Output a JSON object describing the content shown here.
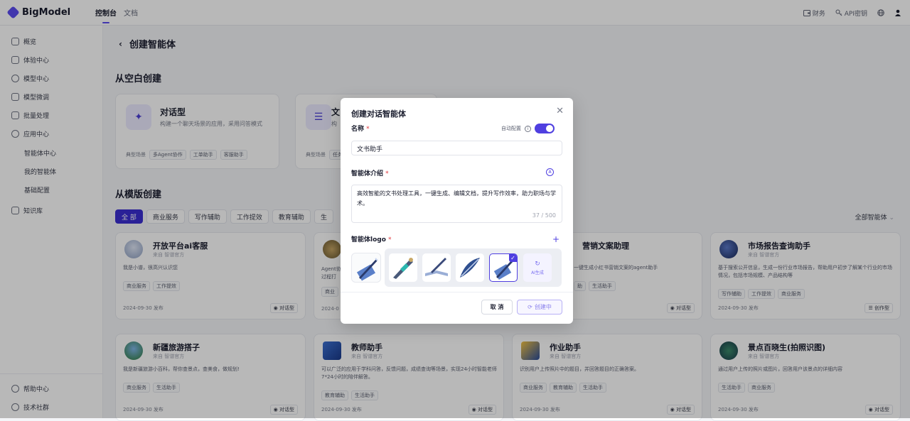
{
  "app": {
    "name": "BigModel"
  },
  "nav": {
    "tabs": [
      {
        "label": "控制台",
        "active": true
      },
      {
        "label": "文档",
        "active": false
      }
    ]
  },
  "topright": {
    "finance": "财务",
    "apikey": "API密钥"
  },
  "sidebar": {
    "items": [
      {
        "label": "概览",
        "icon": "monitor-icon"
      },
      {
        "label": "体验中心",
        "icon": "experience-icon"
      },
      {
        "label": "模型中心",
        "icon": "model-icon"
      },
      {
        "label": "模型微调",
        "icon": "tune-icon"
      },
      {
        "label": "批量处理",
        "icon": "batch-icon"
      },
      {
        "label": "应用中心",
        "icon": "app-icon"
      }
    ],
    "subitems": [
      "智能体中心",
      "我的智能体",
      "基础配置"
    ],
    "kb": "知识库",
    "bottom": [
      {
        "label": "帮助中心",
        "icon": "help-icon"
      },
      {
        "label": "技术社群",
        "icon": "community-icon"
      }
    ]
  },
  "page": {
    "back_title": "创建智能体",
    "blank_title": "从空白创建",
    "template_title": "从模版创建",
    "blank_cards": [
      {
        "title": "对话型",
        "desc": "构建一个聊天场景的应用，采用问答模式",
        "scene_label": "典型场景",
        "tags": [
          "多Agent协作",
          "工单助手",
          "客服助手"
        ]
      },
      {
        "title": "文",
        "desc": "构",
        "scene_label": "典型场景",
        "tags": [
          "任务"
        ]
      }
    ],
    "filters": [
      "全 部",
      "商业服务",
      "写作辅助",
      "工作提效",
      "教育辅助",
      "生"
    ],
    "all_types": "全部智能体",
    "cards": [
      {
        "title": "开放平台ai客服",
        "source": "来自  智谱官方",
        "desc": "我是小谱，很高兴认识您",
        "tags": [
          "商业服务",
          "工作提效"
        ],
        "date": "2024-09-30 发布",
        "type": "对话型"
      },
      {
        "title": "",
        "source": "",
        "desc": "Agent协\n过程打",
        "tags": [
          "商业"
        ],
        "date": "2024-0",
        "type": ""
      },
      {
        "title": "营销文案助理",
        "source": "",
        "desc": "一键生成小红书营销文案的agent助手",
        "tags": [
          "助",
          "生活助手"
        ],
        "date": "",
        "type": "对话型"
      },
      {
        "title": "市场报告查询助手",
        "source": "来自  智谱官方",
        "desc": "基于搜索公开信息，生成一份行业市场报告，帮助用户初步了解某个行业的市场情况，包括市场规模、产品结构等",
        "tags": [
          "写作辅助",
          "工作提效",
          "商业服务"
        ],
        "date": "2024-09-30 发布",
        "type": "创作型"
      },
      {
        "title": "新疆旅游搭子",
        "source": "来自  智谱官方",
        "desc": "我是新疆旅游小百科，帮你查景点，查美食，做规划!",
        "tags": [
          "商业服务",
          "生活助手"
        ],
        "date": "2024-09-30 发布",
        "type": "对话型"
      },
      {
        "title": "教师助手",
        "source": "来自  智谱官方",
        "desc": "可以广泛的应用于学科问答，反馈问题，成绩查询等场景，实现24小时智能老师 7*24小时的陪伴解答。",
        "tags": [
          "教育辅助",
          "生活助手"
        ],
        "date": "2024-09-30 发布",
        "type": "对话型"
      },
      {
        "title": "作业助手",
        "source": "来自  智谱官方",
        "desc": "识别用户上传照片中的题目，并回答题目的正确答案。",
        "tags": [
          "商业服务",
          "教育辅助",
          "生活助手"
        ],
        "date": "2024-09-30 发布",
        "type": "对话型"
      },
      {
        "title": "景点百晓生(拍照识图)",
        "source": "来自  智谱官方",
        "desc": "通过用户上传的照片或图片，回答用户该景点的详细内容",
        "tags": [
          "生活助手",
          "商业服务"
        ],
        "date": "2024-09-30 发布",
        "type": "对话型"
      }
    ]
  },
  "modal": {
    "title": "创建对话智能体",
    "name_label": "名称",
    "required": "*",
    "auto_config": "自动配置",
    "name_value": "文书助手",
    "intro_label": "智能体介绍",
    "intro_value": "高效智能的文书处理工具，一键生成、编辑文档，提升写作效率，助力职场与学术。",
    "counter": "37 / 500",
    "logo_label": "智能体logo",
    "ai_gen": "AI生成",
    "cancel": "取 消",
    "create": "创建中"
  },
  "colors": {
    "accent": "#4f3fe0",
    "brand": "#5b4cf0"
  }
}
